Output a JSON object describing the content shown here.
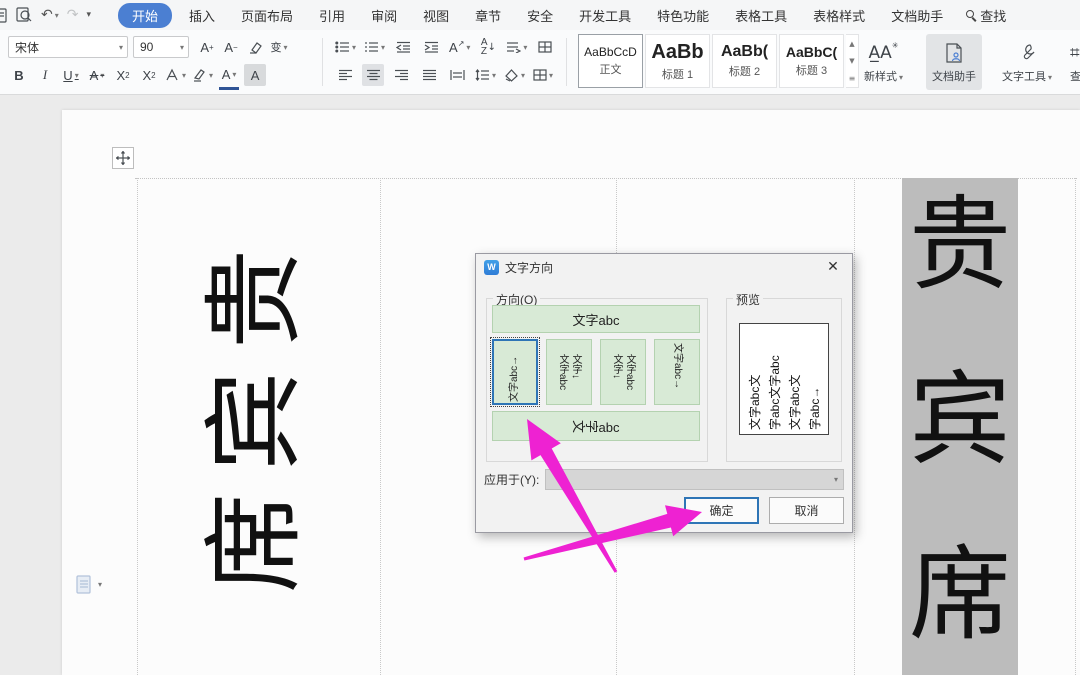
{
  "titlebar": {
    "tabs": [
      {
        "label": "开始",
        "active": true
      },
      {
        "label": "插入"
      },
      {
        "label": "页面布局"
      },
      {
        "label": "引用"
      },
      {
        "label": "审阅"
      },
      {
        "label": "视图"
      },
      {
        "label": "章节"
      },
      {
        "label": "安全"
      },
      {
        "label": "开发工具"
      },
      {
        "label": "特色功能"
      },
      {
        "label": "表格工具"
      },
      {
        "label": "表格样式"
      },
      {
        "label": "文档助手"
      }
    ],
    "search_label": "查找"
  },
  "ribbon": {
    "font_name": "宋体",
    "font_size": "90",
    "styles": [
      {
        "sample": "AaBbCcD",
        "label": "正文"
      },
      {
        "sample": "AaBb",
        "label": "标题 1"
      },
      {
        "sample": "AaBb(",
        "label": "标题 2"
      },
      {
        "sample": "AaBbC(",
        "label": "标题 3"
      }
    ],
    "new_style_label": "新样式",
    "doc_assistant_label": "文档助手",
    "text_tool_label": "文字工具",
    "clipped_label": "查"
  },
  "dialog": {
    "title": "文字方向",
    "direction_group_label": "方向(O)",
    "preview_label": "预览",
    "apply_label": "应用于(Y):",
    "ok_label": "确定",
    "cancel_label": "取消",
    "options": {
      "horizontal": "文字abc",
      "vertical_up": "文字abc→",
      "col_a1": "文字↓",
      "col_a2": "文字abc",
      "col_b1": "文字↓",
      "col_b2": "文字abc",
      "vertical_down": "文字abc→",
      "rotated_char1": "文",
      "rotated_char2": "字",
      "rotated_suffix": "abc"
    },
    "preview_columns": [
      "文字abc文",
      "字abc文字abc",
      "文字abc文",
      "字abc→"
    ]
  },
  "document": {
    "left_chars": [
      "贵",
      "宾",
      "席"
    ],
    "right_chars": [
      "贵",
      "宾",
      "席"
    ]
  },
  "colors": {
    "active_tab": "#4b7fd2",
    "selection_border": "#2e75b6",
    "option_tile_bg": "#d8ead6",
    "annotation_arrow": "#ee22d2",
    "selected_column_bg": "#bcbcbc"
  }
}
